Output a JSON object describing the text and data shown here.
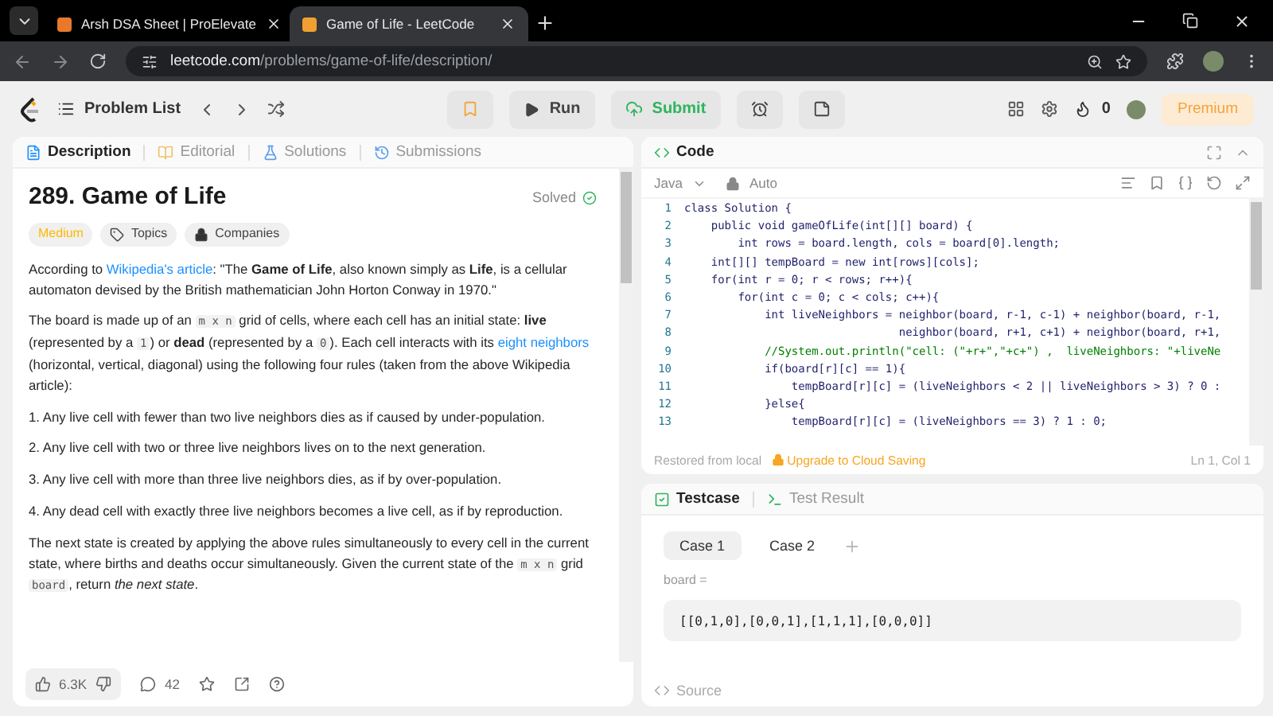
{
  "browser": {
    "tabs": [
      {
        "title": "Arsh DSA Sheet | ProElevate",
        "selected": false
      },
      {
        "title": "Game of Life - LeetCode",
        "selected": true
      }
    ],
    "url": {
      "domain": "leetcode.com",
      "path": "/problems/game-of-life/description/"
    }
  },
  "nav": {
    "problem_list": "Problem List",
    "run": "Run",
    "submit": "Submit",
    "streak": "0",
    "premium": "Premium"
  },
  "description": {
    "tabs": [
      {
        "label": "Description",
        "kind": "description",
        "selected": true
      },
      {
        "label": "Editorial",
        "kind": "editorial",
        "selected": false
      },
      {
        "label": "Solutions",
        "kind": "solutions",
        "selected": false
      },
      {
        "label": "Submissions",
        "kind": "submissions",
        "selected": false
      }
    ],
    "title": "289. Game of Life",
    "status": "Solved",
    "tags": [
      {
        "label": "Medium",
        "kind": "difficulty"
      },
      {
        "label": "Topics",
        "kind": "topics"
      },
      {
        "label": "Companies",
        "kind": "companies"
      }
    ],
    "intro": [
      {
        "kind": "text",
        "text": "According to "
      },
      {
        "kind": "link",
        "text": "Wikipedia's article"
      },
      {
        "kind": "text",
        "text": ": \"The **Game of Life**, also known simply as **Life**, is a cellular automaton devised by the British mathematician John Horton Conway in 1970.\""
      }
    ],
    "board_paragraph": [
      {
        "kind": "text",
        "text": "The board is made up of an "
      },
      {
        "kind": "code",
        "text": "m x n"
      },
      {
        "kind": "text",
        "text": " grid of cells, where each cell has an initial state: **live** (represented by a "
      },
      {
        "kind": "code",
        "text": "1"
      },
      {
        "kind": "text",
        "text": ") or **dead** (represented by a "
      },
      {
        "kind": "code",
        "text": "0"
      },
      {
        "kind": "text",
        "text": "). Each cell interacts with its "
      },
      {
        "kind": "link",
        "text": "eight neighbors"
      },
      {
        "kind": "text",
        "text": " (horizontal, vertical, diagonal) using the following four rules (taken from the above Wikipedia article):"
      }
    ],
    "rules": [
      {
        "number": "1.",
        "text": "Any live cell with fewer than two live neighbors dies as if caused by under-population."
      },
      {
        "number": "2.",
        "text": "Any live cell with two or three live neighbors lives on to the next generation."
      },
      {
        "number": "3.",
        "text": "Any live cell with more than three live neighbors dies, as if by over-population."
      },
      {
        "number": "4.",
        "text": "Any dead cell with exactly three live neighbors becomes a live cell, as if by reproduction."
      }
    ],
    "closing": [
      {
        "kind": "text",
        "text": "The next state is created by applying the above rules simultaneously to every cell in the current state, where births and deaths occur simultaneously. Given the current state of the "
      },
      {
        "kind": "code",
        "text": "m x n"
      },
      {
        "kind": "text",
        "text": " grid "
      },
      {
        "kind": "code",
        "text": "board"
      },
      {
        "kind": "text",
        "text": ", return *the next state*."
      }
    ],
    "likes": "6.3K",
    "comments": "42"
  },
  "code": {
    "title": "Code",
    "language": "Java",
    "mode": "Auto",
    "lines": [
      {
        "no": "1",
        "kind": "code",
        "text": "class Solution {"
      },
      {
        "no": "2",
        "kind": "code",
        "text": "    public void gameOfLife(int[][] board) {"
      },
      {
        "no": "3",
        "kind": "code",
        "text": "        int rows = board.length, cols = board[0].length;"
      },
      {
        "no": "4",
        "kind": "code",
        "text": "    int[][] tempBoard = new int[rows][cols];"
      },
      {
        "no": "5",
        "kind": "code",
        "text": "    for(int r = 0; r < rows; r++){"
      },
      {
        "no": "6",
        "kind": "code",
        "text": "        for(int c = 0; c < cols; c++){"
      },
      {
        "no": "7",
        "kind": "code",
        "text": "            int liveNeighbors = neighbor(board, r-1, c-1) + neighbor(board, r-1,"
      },
      {
        "no": "8",
        "kind": "code",
        "text": "                                neighbor(board, r+1, c+1) + neighbor(board, r+1,"
      },
      {
        "no": "9",
        "kind": "comment",
        "text": "            //System.out.println(\"cell: (\"+r+\",\"+c+\") ,  liveNeighbors: \"+liveNe"
      },
      {
        "no": "10",
        "kind": "code",
        "text": "            if(board[r][c] == 1){"
      },
      {
        "no": "11",
        "kind": "code",
        "text": "                tempBoard[r][c] = (liveNeighbors < 2 || liveNeighbors > 3) ? 0 :"
      },
      {
        "no": "12",
        "kind": "code",
        "text": "            }else{"
      },
      {
        "no": "13",
        "kind": "code",
        "text": "                tempBoard[r][c] = (liveNeighbors == 3) ? 1 : 0;"
      }
    ],
    "restored": "Restored from local",
    "upgrade": "Upgrade to Cloud Saving",
    "position": "Ln 1, Col 1"
  },
  "testcase": {
    "tabs": [
      {
        "label": "Testcase",
        "kind": "testcase",
        "selected": true
      },
      {
        "label": "Test Result",
        "kind": "result",
        "selected": false
      }
    ],
    "cases": [
      {
        "label": "Case 1",
        "selected": true
      },
      {
        "label": "Case 2",
        "selected": false
      }
    ],
    "param": "board =",
    "value": "[[0,1,0],[0,0,1],[1,1,1],[0,0,0]]",
    "source": "Source"
  }
}
